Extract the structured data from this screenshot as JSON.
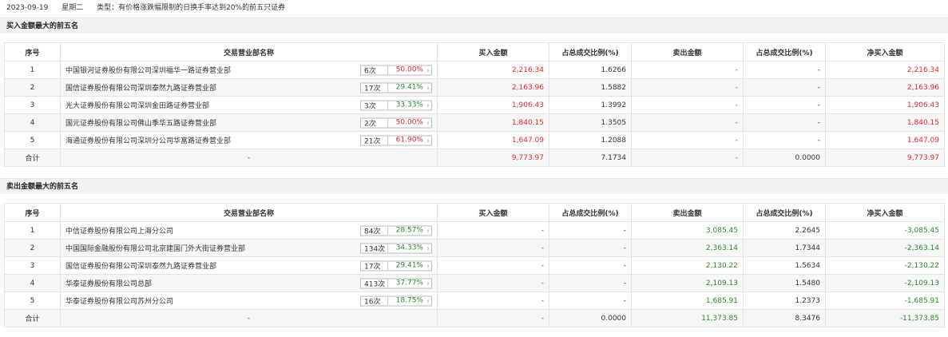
{
  "header": {
    "date": "2023-09-19",
    "weekday": "星期二",
    "type_text": "类型：有价格涨跌幅限制的日换手率达到20%的前五只证券"
  },
  "columns": [
    "序号",
    "交易营业部名称",
    "买入金额",
    "占总成交比例(%)",
    "卖出金额",
    "占总成交比例(%)",
    "净买入金额"
  ],
  "buy_section": {
    "title": "买入金额最大的前五名",
    "rows": [
      {
        "idx": "1",
        "name": "中国银河证券股份有限公司深圳福华一路证券营业部",
        "count": "6次",
        "pct": "50.00%",
        "pct_color": "#e5252c",
        "buy": "2,216.34",
        "buy_ratio": "1.6266",
        "sell": "-",
        "sell_ratio": "-",
        "net": "2,216.34"
      },
      {
        "idx": "2",
        "name": "国信证券股份有限公司深圳泰然九路证券营业部",
        "count": "17次",
        "pct": "29.41%",
        "pct_color": "#2a8a2a",
        "buy": "2,163.96",
        "buy_ratio": "1.5882",
        "sell": "-",
        "sell_ratio": "-",
        "net": "2,163.96"
      },
      {
        "idx": "3",
        "name": "光大证券股份有限公司深圳金田路证券营业部",
        "count": "3次",
        "pct": "33.33%",
        "pct_color": "#2a8a2a",
        "buy": "1,906.43",
        "buy_ratio": "1.3992",
        "sell": "-",
        "sell_ratio": "-",
        "net": "1,906.43"
      },
      {
        "idx": "4",
        "name": "国元证券股份有限公司佛山季华五路证券营业部",
        "count": "2次",
        "pct": "50.00%",
        "pct_color": "#e5252c",
        "buy": "1,840.15",
        "buy_ratio": "1.3505",
        "sell": "-",
        "sell_ratio": "-",
        "net": "1,840.15"
      },
      {
        "idx": "5",
        "name": "海通证券股份有限公司深圳分公司华富路证券营业部",
        "count": "21次",
        "pct": "61.90%",
        "pct_color": "#e5252c",
        "buy": "1,647.09",
        "buy_ratio": "1.2088",
        "sell": "-",
        "sell_ratio": "-",
        "net": "1,647.09"
      }
    ],
    "total": {
      "label": "合计",
      "name": "-",
      "buy": "9,773.97",
      "buy_ratio": "7.1734",
      "sell": "-",
      "sell_ratio": "0.0000",
      "net": "9,773.97"
    }
  },
  "sell_section": {
    "title": "卖出金额最大的前五名",
    "rows": [
      {
        "idx": "1",
        "name": "中信证券股份有限公司上海分公司",
        "count": "84次",
        "pct": "28.57%",
        "pct_color": "#2a8a2a",
        "buy": "-",
        "buy_ratio": "-",
        "sell": "3,085.45",
        "sell_ratio": "2.2645",
        "net": "-3,085.45"
      },
      {
        "idx": "2",
        "name": "中国国际金融股份有限公司北京建国门外大街证券营业部",
        "count": "134次",
        "pct": "34.33%",
        "pct_color": "#2a8a2a",
        "buy": "-",
        "buy_ratio": "-",
        "sell": "2,363.14",
        "sell_ratio": "1.7344",
        "net": "-2,363.14"
      },
      {
        "idx": "3",
        "name": "国信证券股份有限公司深圳泰然九路证券营业部",
        "count": "17次",
        "pct": "29.41%",
        "pct_color": "#2a8a2a",
        "buy": "-",
        "buy_ratio": "-",
        "sell": "2,130.22",
        "sell_ratio": "1.5634",
        "net": "-2,130.22"
      },
      {
        "idx": "4",
        "name": "华泰证券股份有限公司总部",
        "count": "413次",
        "pct": "37.77%",
        "pct_color": "#2a8a2a",
        "buy": "-",
        "buy_ratio": "-",
        "sell": "2,109.13",
        "sell_ratio": "1.5480",
        "net": "-2,109.13"
      },
      {
        "idx": "5",
        "name": "华泰证券股份有限公司苏州分公司",
        "count": "16次",
        "pct": "18.75%",
        "pct_color": "#2a8a2a",
        "buy": "-",
        "buy_ratio": "-",
        "sell": "1,685.91",
        "sell_ratio": "1.2373",
        "net": "-1,685.91"
      }
    ],
    "total": {
      "label": "合计",
      "name": "-",
      "buy": "-",
      "buy_ratio": "0.0000",
      "sell": "11,373.85",
      "sell_ratio": "8.3476",
      "net": "-11,373.85"
    }
  },
  "colors": {
    "red": "#e5252c",
    "green": "#2a8a2a",
    "arrow_icon": "chevron-right-icon"
  }
}
